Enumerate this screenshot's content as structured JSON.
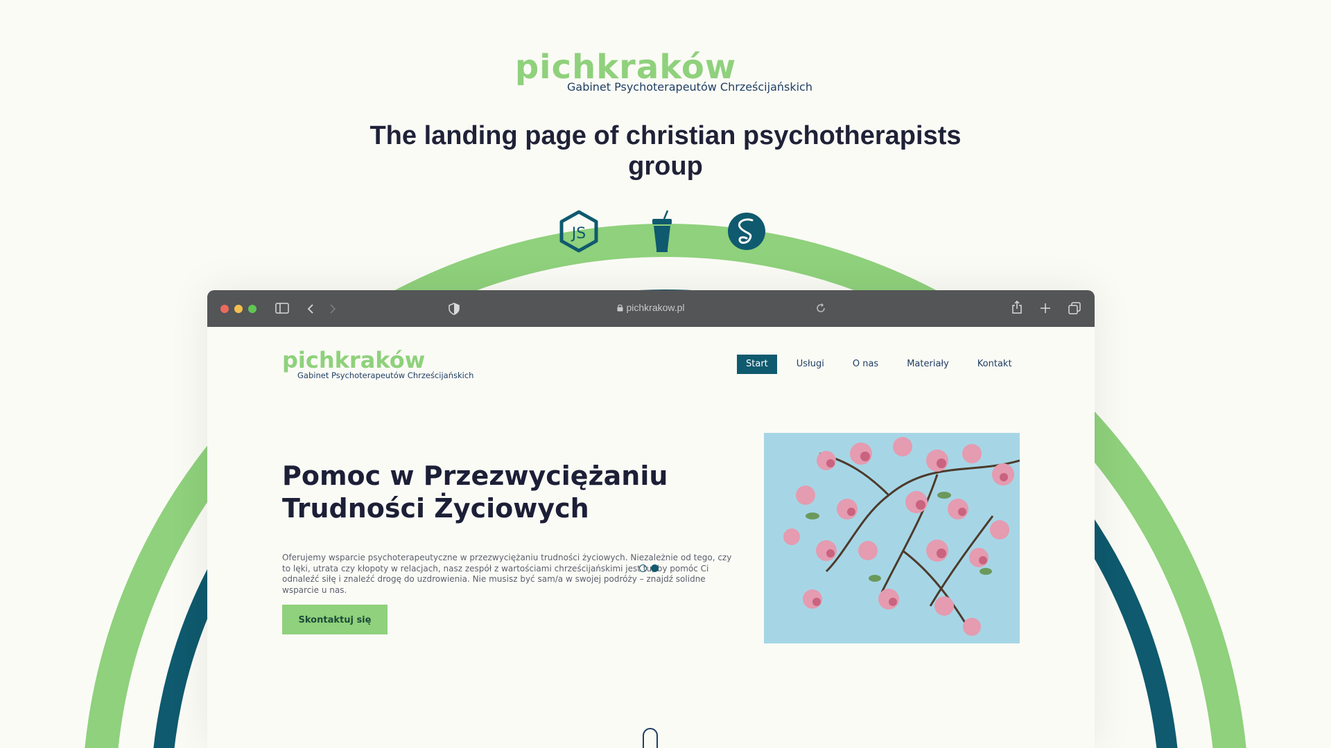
{
  "header": {
    "brand": "pichkraków",
    "brand_subtitle": "Gabinet Psychoterapeutów Chrześcijańskich",
    "headline_line1": "The landing page of christian psychotherapists",
    "headline_line2": "group"
  },
  "tech_icons": [
    "nodejs-icon",
    "gulp-icon",
    "sass-icon"
  ],
  "browser": {
    "url": "pichkrakow.pl",
    "traffic_lights": [
      "#ec6a5e",
      "#f4bf4f",
      "#61c554"
    ]
  },
  "site": {
    "brand": "pichkraków",
    "brand_subtitle": "Gabinet Psychoterapeutów Chrześcijańskich",
    "nav": [
      "Start",
      "Usługi",
      "O nas",
      "Materiały",
      "Kontakt"
    ],
    "active_nav": "Start",
    "hero_title_line1": "Pomoc w Przezwyciężaniu",
    "hero_title_line2": "Trudności Życiowych",
    "hero_text": "Oferujemy wsparcie psychoterapeutyczne w przezwyciężaniu trudności życiowych. Niezależnie od tego, czy to lęki, utrata czy kłopoty w relacjach, nasz zespół z wartościami chrześcijańskimi jest tu, by pomóc Ci odnaleźć siłę i znaleźć drogę do uzdrowienia. Nie musisz być sam/a w swojej podróży – znajdź solidne wsparcie u nas.",
    "cta_label": "Skontaktuj się",
    "slider_count": 2,
    "slider_active": 2
  },
  "colors": {
    "brand_green": "#8fd17c",
    "brand_teal": "#0f5a6e",
    "navy": "#1f3f63",
    "background": "#fbfbf6"
  }
}
